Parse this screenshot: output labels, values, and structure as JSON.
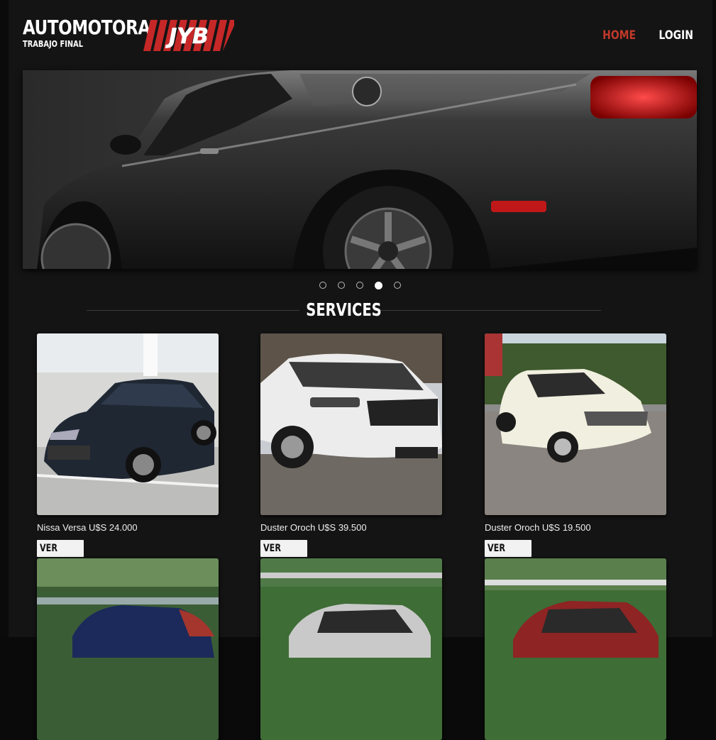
{
  "header": {
    "brand_title": "AUTOMOTORA",
    "brand_subtitle": "TRABAJO FINAL",
    "logo_text": "JYB",
    "nav": [
      {
        "label": "HOME",
        "active": true
      },
      {
        "label": "LOGIN",
        "active": false
      }
    ]
  },
  "carousel": {
    "slides": 5,
    "active_index": 3
  },
  "section": {
    "title": "SERVICES"
  },
  "cars": [
    {
      "caption": "Nissa Versa U$S 24.000",
      "button": "VER MAS",
      "color": "#1f2733"
    },
    {
      "caption": "Duster Oroch U$S 39.500",
      "button": "VER MAS",
      "color": "#e9e9e9"
    },
    {
      "caption": "Duster Oroch U$S 19.500",
      "button": "VER MAS",
      "color": "#f1efdf"
    },
    {
      "caption": "",
      "button": "",
      "color": "#1b2a5a"
    },
    {
      "caption": "",
      "button": "",
      "color": "#c9c9c9"
    },
    {
      "caption": "",
      "button": "",
      "color": "#8e2424"
    }
  ],
  "colors": {
    "accent": "#c0392b",
    "background": "#141414"
  }
}
